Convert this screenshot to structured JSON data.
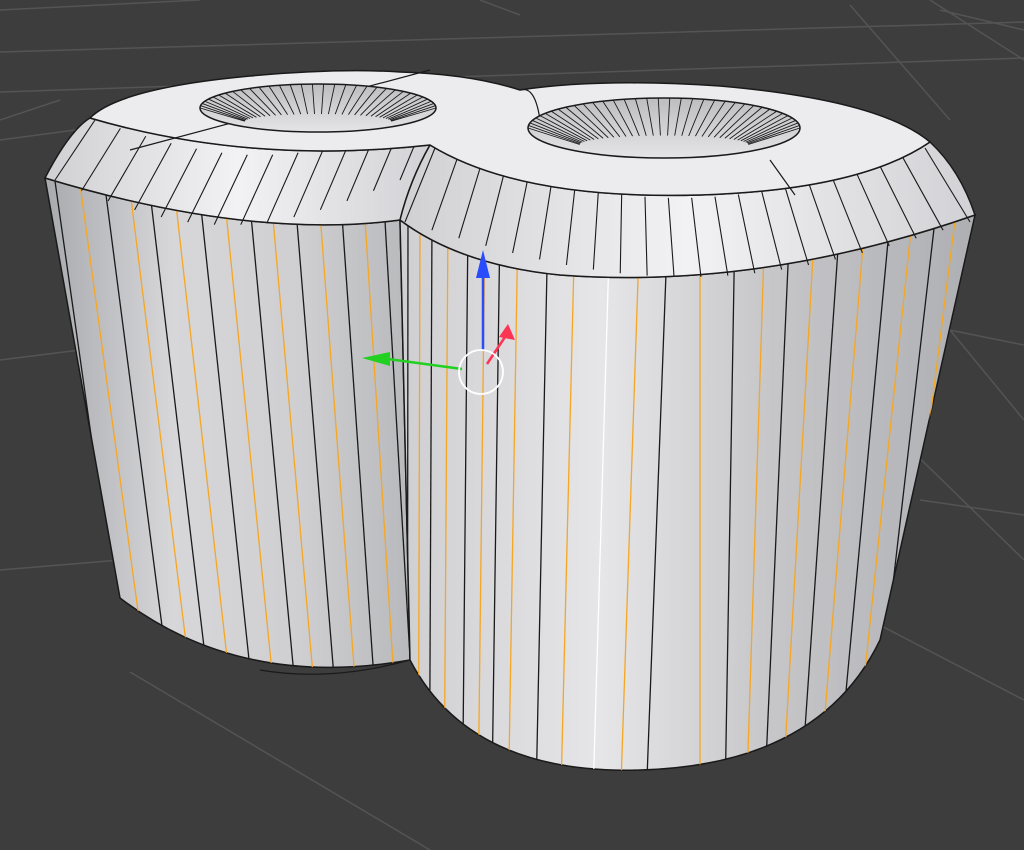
{
  "viewport": {
    "background": "#3d3d3d",
    "grid_color": "#545454"
  },
  "mesh": {
    "name_icon": "cylinder-mesh-icon",
    "colors": {
      "face_light": "#f0f0f2",
      "face_mid": "#dcdcdf",
      "face_dark": "#a9aaae",
      "edge": "#1a1a1a",
      "selected_edge": "#f5a623",
      "active_edge": "#ffffff"
    }
  },
  "gizmo": {
    "x_axis_color": "#ff3352",
    "y_axis_color": "#22d022",
    "z_axis_color": "#2a4cff",
    "pivot_color": "#ffffff"
  }
}
